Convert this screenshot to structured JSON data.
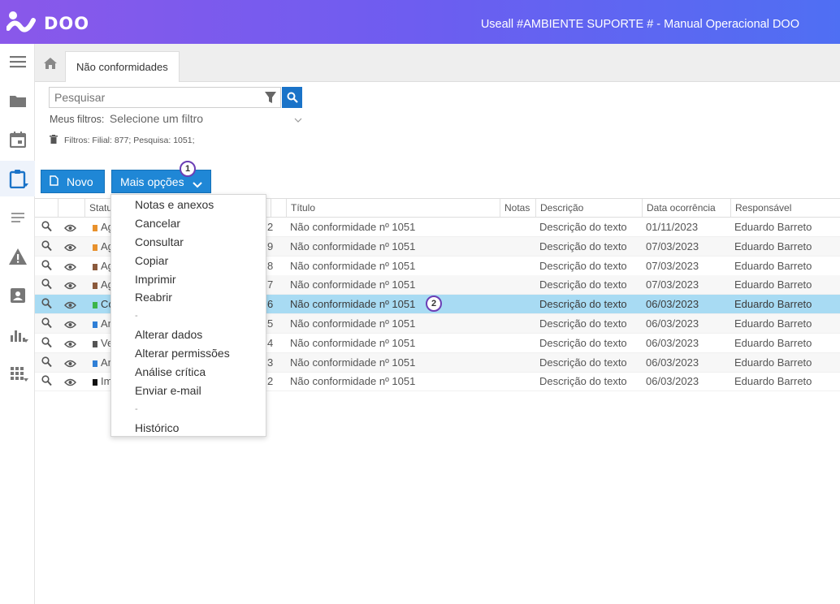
{
  "header": {
    "logo_text": "DOO",
    "app_title": "Useall #AMBIENTE SUPORTE # - Manual Operacional DOO"
  },
  "sidebar": {
    "items": [
      "menu-icon",
      "folder-icon",
      "calendar-icon",
      "clipboard-icon",
      "list-icon",
      "warning-icon",
      "contact-icon",
      "chart-icon",
      "apps-icon"
    ]
  },
  "tabs": {
    "active": "Não conformidades"
  },
  "search": {
    "placeholder": "Pesquisar"
  },
  "filters": {
    "label": "Meus filtros:",
    "selected": "Selecione um filtro",
    "active_filters": "Filtros: Filial: 877; Pesquisa: 1051;"
  },
  "toolbar": {
    "new_label": "Novo",
    "more_label": "Mais opções"
  },
  "annotations": {
    "badge1": "1",
    "badge2": "2"
  },
  "colors": {
    "accent": "#1f87d6",
    "header_start": "#8a58ea",
    "header_end": "#4f6ff3",
    "selected_row": "#a8dbf3"
  },
  "grid": {
    "columns": [
      "",
      "",
      "Status",
      "",
      "Título",
      "Notas",
      "Descrição",
      "Data ocorrência",
      "Responsável"
    ],
    "rows": [
      {
        "status": "Ag",
        "status_color": "#e8912d",
        "num": "2",
        "title": "Não conformidade nº 1051",
        "desc": "Descrição do texto",
        "date": "01/11/2023",
        "resp": "Eduardo Barreto"
      },
      {
        "status": "Ag",
        "status_color": "#e8912d",
        "num": "9",
        "title": "Não conformidade nº 1051",
        "desc": "Descrição do texto",
        "date": "07/03/2023",
        "resp": "Eduardo Barreto"
      },
      {
        "status": "Ag",
        "status_color": "#8b5a3c",
        "num": "8",
        "title": "Não conformidade nº 1051",
        "desc": "Descrição do texto",
        "date": "07/03/2023",
        "resp": "Eduardo Barreto"
      },
      {
        "status": "Ag",
        "status_color": "#8b5a3c",
        "num": "7",
        "title": "Não conformidade nº 1051",
        "desc": "Descrição do texto",
        "date": "07/03/2023",
        "resp": "Eduardo Barreto"
      },
      {
        "status": "Co",
        "status_color": "#3cb54a",
        "num": "6",
        "title": "Não conformidade nº 1051",
        "desc": "Descrição do texto",
        "date": "06/03/2023",
        "resp": "Eduardo Barreto"
      },
      {
        "status": "An",
        "status_color": "#2f7fd6",
        "num": "5",
        "title": "Não conformidade nº 1051",
        "desc": "Descrição do texto",
        "date": "06/03/2023",
        "resp": "Eduardo Barreto"
      },
      {
        "status": "Ve",
        "status_color": "#555555",
        "num": "4",
        "title": "Não conformidade nº 1051",
        "desc": "Descrição do texto",
        "date": "06/03/2023",
        "resp": "Eduardo Barreto"
      },
      {
        "status": "An",
        "status_color": "#2f7fd6",
        "num": "3",
        "title": "Não conformidade nº 1051",
        "desc": "Descrição do texto",
        "date": "06/03/2023",
        "resp": "Eduardo Barreto"
      },
      {
        "status": "Im",
        "status_color": "#111111",
        "num": "2",
        "title": "Não conformidade nº 1051",
        "desc": "Descrição do texto",
        "date": "06/03/2023",
        "resp": "Eduardo Barreto"
      }
    ]
  },
  "menu": {
    "items": [
      "Notas e anexos",
      "Cancelar",
      "Consultar",
      "Copiar",
      "Imprimir",
      "Reabrir",
      "-",
      "Alterar dados",
      "Alterar permissões",
      "Análise crítica",
      "Enviar e-mail",
      "-",
      "Histórico"
    ]
  }
}
